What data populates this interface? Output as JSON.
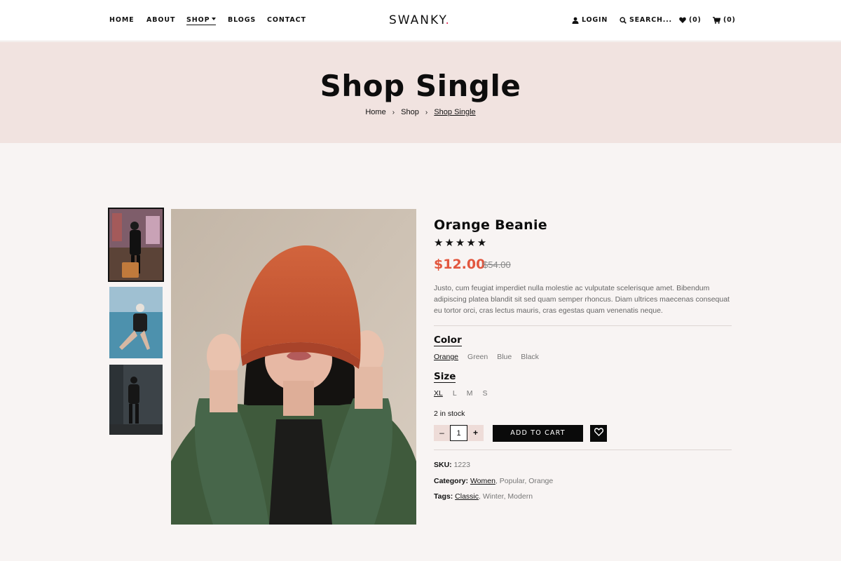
{
  "header": {
    "nav": {
      "home": "HOME",
      "about": "ABOUT",
      "shop": "SHOP",
      "blogs": "BLOGS",
      "contact": "CONTACT"
    },
    "logo": "SWANKY",
    "logo_dot": ".",
    "login": "LOGIN",
    "search": "SEARCH...",
    "wishlist_count": "(0)",
    "cart_count": "(0)"
  },
  "hero": {
    "title": "Shop Single",
    "breadcrumb": [
      "Home",
      "Shop",
      "Shop Single"
    ]
  },
  "product": {
    "title": "Orange Beanie",
    "stars": "★★★★★",
    "price": "$12.00",
    "old_price": "$54.00",
    "description": "Justo, cum feugiat imperdiet nulla molestie ac vulputate scelerisque amet. Bibendum adipiscing platea blandit sit sed quam semper rhoncus. Diam ultrices maecenas consequat eu tortor orci, cras lectus mauris, cras egestas quam venenatis neque.",
    "color_label": "Color",
    "colors": [
      "Orange",
      "Green",
      "Blue",
      "Black"
    ],
    "size_label": "Size",
    "sizes": [
      "XL",
      "L",
      "M",
      "S"
    ],
    "stock": "2 in stock",
    "qty_minus": "–",
    "qty_value": "1",
    "qty_plus": "+",
    "add_to_cart": "ADD TO CART",
    "sku_label": "SKU:",
    "sku": "1223",
    "category_label": "Category:",
    "category_link": "Women",
    "category_rest": ", Popular, Orange",
    "tags_label": "Tags:",
    "tags_link": "Classic",
    "tags_rest": ", Winter, Modern"
  },
  "colors": {
    "accent_price": "#e2573f",
    "logo_dot": "#e1325a",
    "hero_bg": "#f1e3e0",
    "page_bg": "#f8f4f3"
  }
}
